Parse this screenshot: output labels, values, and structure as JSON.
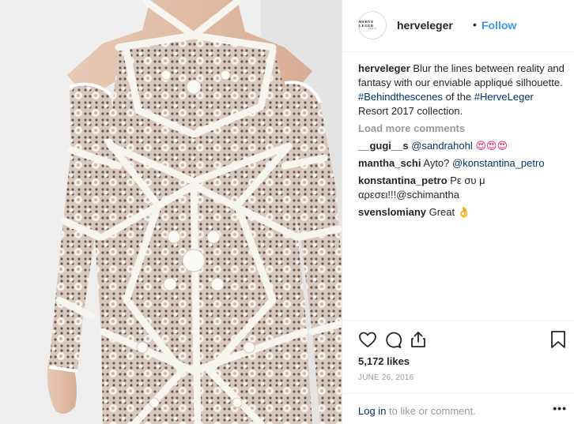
{
  "post": {
    "photo_alt": "",
    "avatar": {
      "line1": "HERVE LEGER",
      "line2": "PARIS"
    },
    "header": {
      "username": "herveleger",
      "separator": "•",
      "follow_label": "Follow"
    },
    "caption": {
      "username": "herveleger",
      "text_1": " Blur the lines between reality and fantasy with our enviable appliqué silhouette. ",
      "hashtag_1": "#Behindthescenes",
      "text_2": " of the ",
      "hashtag_2": "#HerveLeger",
      "text_3": " Resort 2017 collection."
    },
    "load_more_label": "Load more comments",
    "comments": [
      {
        "username": "__gugi__s",
        "mention": "@sandrahohl",
        "emoji": "😍😍😍",
        "text": ""
      },
      {
        "username": "mantha_schi",
        "text": " Ayto? ",
        "mention": "@konstantina_petro",
        "emoji": ""
      },
      {
        "username": "konstantina_petro",
        "text": " Ρε συ μ αρεσει!!!@schimantha",
        "mention": "",
        "emoji": ""
      },
      {
        "username": "svenslomiany",
        "text": " Great ",
        "mention": "",
        "emoji": "👌"
      }
    ],
    "actions": {
      "like_icon": "heart-icon",
      "comment_icon": "comment-icon",
      "share_icon": "share-icon",
      "save_icon": "bookmark-icon"
    },
    "likes_label": "5,172 likes",
    "date_label": "JUNE 26, 2016",
    "login": {
      "link_label": "Log in",
      "rest_label": " to like or comment.",
      "more_label": "•••"
    },
    "colors": {
      "accent": "#3897f0",
      "link": "#003569",
      "muted": "#999999",
      "text": "#262626"
    }
  }
}
